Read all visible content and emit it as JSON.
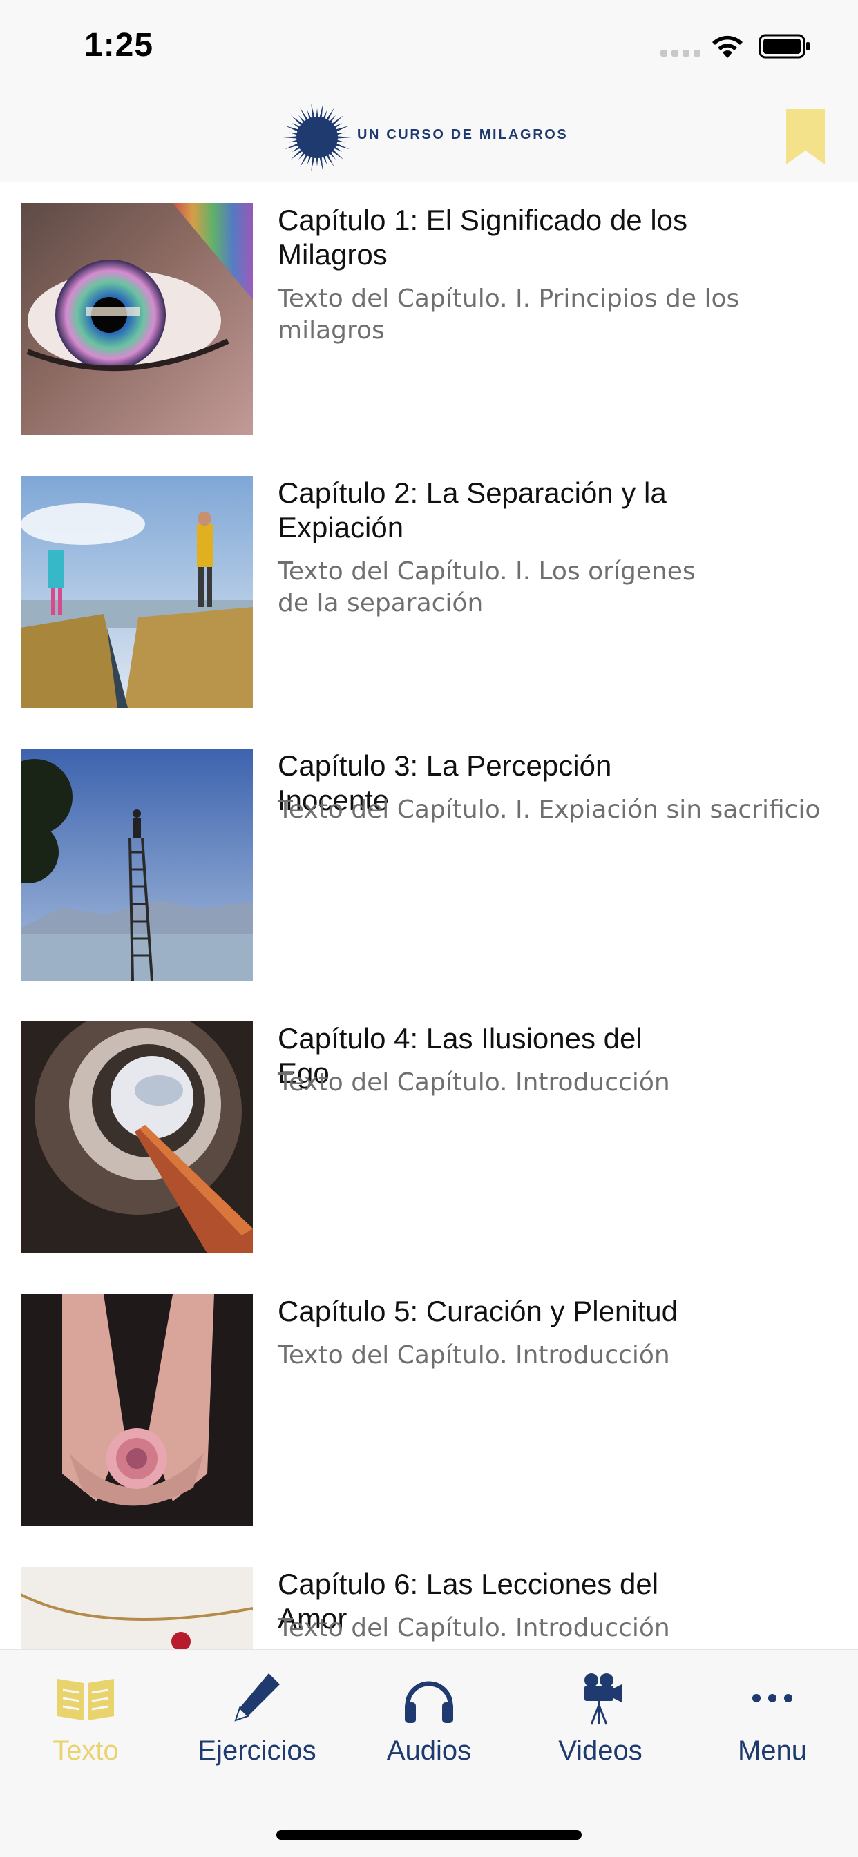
{
  "status_bar": {
    "time": "1:25",
    "icons": [
      "cellular-signal-icon",
      "wifi-icon",
      "battery-icon"
    ]
  },
  "header": {
    "logo_icon": "starburst-logo-icon",
    "logo_text": "UN CURSO DE MILAGROS",
    "bookmark_icon": "bookmark-icon"
  },
  "colors": {
    "brand_navy": "#1e3a6e",
    "accent_yellow": "#f4e28a",
    "active_tab": "#e8d36c"
  },
  "chapters": [
    {
      "title": "Capítulo 1: El Significado de los Milagros",
      "subtitle": "Texto del Capítulo. I. Principios de los milagros",
      "thumbnail": "rainbow-eye-photo"
    },
    {
      "title": "Capítulo 2: La Separación y la Expiación",
      "subtitle": "Texto del Capítulo. I. Los orígenes de la separación",
      "thumbnail": "child-and-adult-on-cliffs-photo"
    },
    {
      "title": "Capítulo 3: La Percepción Inocente",
      "subtitle": "Texto del Capítulo. I. Expiación sin sacrificio",
      "thumbnail": "person-on-ladder-photo"
    },
    {
      "title": "Capítulo 4: Las Ilusiones del Ego",
      "subtitle": "Texto del Capítulo. Introducción",
      "thumbnail": "spiral-staircase-photo"
    },
    {
      "title": "Capítulo 5: Curación y Plenitud",
      "subtitle": "Texto del Capítulo. Introducción",
      "thumbnail": "hands-holding-flower-photo"
    },
    {
      "title": "Capítulo 6: Las Lecciones del Amor",
      "subtitle": "Texto del Capítulo. Introducción",
      "thumbnail": "string-with-red-object-photo"
    }
  ],
  "tabs": [
    {
      "label": "Texto",
      "icon": "open-book-icon",
      "active": true
    },
    {
      "label": "Ejercicios",
      "icon": "pencil-icon",
      "active": false
    },
    {
      "label": "Audios",
      "icon": "headphones-icon",
      "active": false
    },
    {
      "label": "Videos",
      "icon": "video-camera-icon",
      "active": false
    },
    {
      "label": "Menu",
      "icon": "more-dots-icon",
      "active": false
    }
  ]
}
